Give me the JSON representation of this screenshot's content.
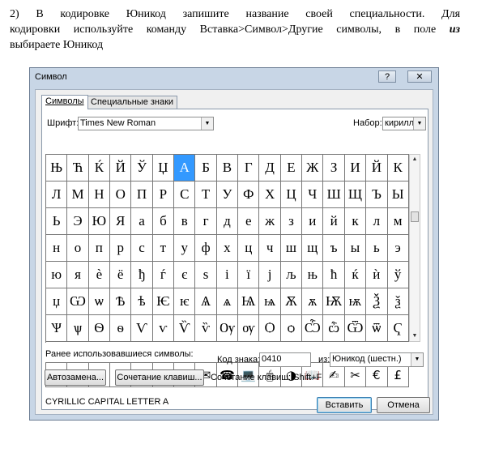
{
  "instruction": {
    "number": "2)",
    "line1": "В кодировке Юникод запишите название своей специальности. Для",
    "line2_a": "кодировки используйте команду Вставка>Символ>Другие символы, в поле ",
    "line2_b": "из",
    "line3": "выбираете Юникод"
  },
  "dialog": {
    "title": "Символ",
    "help_button": "?",
    "close_button": "✕",
    "tabs": [
      "Символы",
      "Специальные знаки"
    ],
    "font": {
      "label": "Шрифт:",
      "value": "Times New Roman"
    },
    "subset": {
      "label": "Набор:",
      "value": "кирилли"
    },
    "symbols": [
      [
        "Њ",
        "Ћ",
        "Ќ",
        "Й",
        "Ў",
        "Џ",
        "А",
        "Б",
        "В",
        "Г",
        "Д",
        "Е",
        "Ж",
        "З",
        "И",
        "Й",
        "К"
      ],
      [
        "Л",
        "М",
        "Н",
        "О",
        "П",
        "Р",
        "С",
        "Т",
        "У",
        "Ф",
        "Х",
        "Ц",
        "Ч",
        "Ш",
        "Щ",
        "Ъ",
        "Ы"
      ],
      [
        "Ь",
        "Э",
        "Ю",
        "Я",
        "а",
        "б",
        "в",
        "г",
        "д",
        "е",
        "ж",
        "з",
        "и",
        "й",
        "к",
        "л",
        "м"
      ],
      [
        "н",
        "о",
        "п",
        "р",
        "с",
        "т",
        "у",
        "ф",
        "х",
        "ц",
        "ч",
        "ш",
        "щ",
        "ъ",
        "ы",
        "ь",
        "э"
      ],
      [
        "ю",
        "я",
        "ѐ",
        "ё",
        "ђ",
        "ѓ",
        "є",
        "ѕ",
        "і",
        "ї",
        "ј",
        "љ",
        "њ",
        "ћ",
        "ќ",
        "ѝ",
        "ў"
      ],
      [
        "џ",
        "Ѡ",
        "ѡ",
        "Ѣ",
        "ѣ",
        "Ѥ",
        "ѥ",
        "Ѧ",
        "ѧ",
        "Ѩ",
        "ѩ",
        "Ѫ",
        "ѫ",
        "Ѭ",
        "ѭ",
        "Ѯ",
        "ѯ"
      ],
      [
        "Ѱ",
        "ѱ",
        "Ѳ",
        "ѳ",
        "Ѵ",
        "ѵ",
        "Ѷ",
        "ѷ",
        "Ѹ",
        "ѹ",
        "Ѻ",
        "ѻ",
        "Ѽ",
        "ѽ",
        "Ѿ",
        "ѿ",
        "Ҁ"
      ]
    ],
    "selected_symbol": "А",
    "recent_label": "Ранее использовавшиеся символы:",
    "recent_symbols": [
      "-",
      "•",
      "→",
      "➔",
      "➜",
      "·",
      "·",
      "✉",
      "☎",
      "💻",
      "🖱",
      "◑",
      "📖",
      "✍",
      "✂",
      "€",
      "£"
    ],
    "char_name": "CYRILLIC CAPITAL LETTER A",
    "code": {
      "label": "Код знака:",
      "value": "0410"
    },
    "from": {
      "label": "из:",
      "value": "Юникод (шестн.)"
    },
    "autocorrect_button": "Автозамена...",
    "shortcut_button": "Сочетание клавиш...",
    "shortcut_text": "Сочетание клавиш: Shift+F",
    "insert_button": "Вставить",
    "cancel_button": "Отмена"
  }
}
